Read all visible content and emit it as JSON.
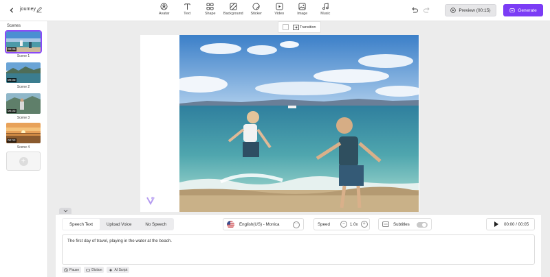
{
  "header": {
    "project_title": "journey",
    "toolbar": [
      {
        "label": "Avatar",
        "icon": "avatar-icon"
      },
      {
        "label": "Text",
        "icon": "text-icon"
      },
      {
        "label": "Shape",
        "icon": "shape-icon"
      },
      {
        "label": "Background",
        "icon": "background-icon"
      },
      {
        "label": "Sticker",
        "icon": "sticker-icon"
      },
      {
        "label": "Video",
        "icon": "video-icon"
      },
      {
        "label": "Image",
        "icon": "image-icon"
      },
      {
        "label": "Music",
        "icon": "music-icon"
      }
    ],
    "preview_label": "Preview (00:15)",
    "generate_label": "Generate"
  },
  "sidebar": {
    "title": "Scenes",
    "scenes": [
      {
        "name": "Scene 1",
        "duration": "00:05",
        "selected": true
      },
      {
        "name": "Scene 2",
        "duration": "00:03",
        "selected": false
      },
      {
        "name": "Scene 3",
        "duration": "00:03",
        "selected": false
      },
      {
        "name": "Scene 4",
        "duration": "00:03",
        "selected": false
      }
    ],
    "add_label": "+"
  },
  "canvas": {
    "transition_label": "Transition"
  },
  "bottom_panel": {
    "tabs": [
      {
        "label": "Speech Text",
        "active": true
      },
      {
        "label": "Upload Voice",
        "active": false
      },
      {
        "label": "No Speech",
        "active": false
      }
    ],
    "voice": "English(US) - Monica",
    "more_symbol": "···",
    "speed_label": "Speed",
    "speed_value": "1.0x",
    "minus_symbol": "−",
    "plus_symbol": "+",
    "subtitles_label": "Subtitles",
    "subtitles_enabled": false,
    "playback_time": "00:00 / 00:05",
    "speech_text": "The first day of travel, playing in the water at the beach.",
    "chips": [
      {
        "label": "Pause",
        "icon": "clock-icon"
      },
      {
        "label": "Diction",
        "icon": "diction-icon"
      },
      {
        "label": "AI Script",
        "icon": "ai-script-icon"
      }
    ]
  },
  "colors": {
    "accent": "#7b3cf5",
    "selection": "#8a4af7"
  }
}
